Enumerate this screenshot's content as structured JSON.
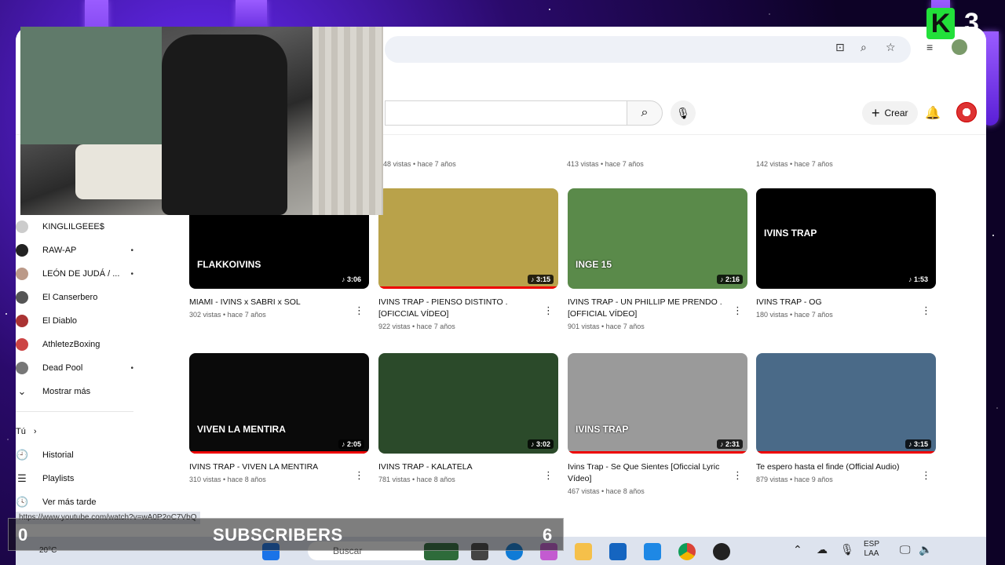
{
  "header": {
    "create_label": "Crear"
  },
  "taskbar": {
    "search_placeholder": "Buscar",
    "lang_top": "ESP",
    "lang_bottom": "LAA",
    "temp": "20°C"
  },
  "status": {
    "url": "https://www.youtube.com/watch?v=wA0P2oC7VbQ"
  },
  "overlay": {
    "subs_left": "0",
    "subs_label": "SUBSCRIBERS",
    "subs_right": "6",
    "brand_letter": "K",
    "brand_number": "3"
  },
  "top_row_meta": [
    "48 vistas • hace 7 años",
    "413 vistas • hace 7 años",
    "142 vistas • hace 7 años"
  ],
  "sidebar": {
    "subscriptions": [
      {
        "name": "KINGLILGEEE$",
        "dot": "",
        "color": "#ccc"
      },
      {
        "name": "RAW-AP",
        "dot": "•",
        "color": "#222"
      },
      {
        "name": "LEÓN DE JUDÁ / ...",
        "dot": "•",
        "color": "#b98"
      },
      {
        "name": "El Canserbero",
        "dot": "",
        "color": "#555"
      },
      {
        "name": "El Diablo",
        "dot": "",
        "color": "#a33"
      },
      {
        "name": "AthletezBoxing",
        "dot": "",
        "color": "#c44"
      },
      {
        "name": "Dead Pool",
        "dot": "•",
        "color": "#777"
      }
    ],
    "show_more": "Mostrar más",
    "you_label": "Tú",
    "you_items": [
      {
        "label": "Historial",
        "icon": "history-icon"
      },
      {
        "label": "Playlists",
        "icon": "playlist-icon"
      },
      {
        "label": "Ver más tarde",
        "icon": "watch-later-icon"
      }
    ]
  },
  "videos": [
    {
      "title": "MIAMI - IVINS x SABRI x SOL",
      "meta": "302 vistas • hace 7 años",
      "duration": "3:06",
      "thumb_text": "FLAKKOIVINS",
      "bg": "#000"
    },
    {
      "title": "IVINS TRAP - PIENSO DISTINTO . [OFICCIAL VÍDEO]",
      "meta": "922 vistas • hace 7 años",
      "duration": "3:15",
      "thumb_text": "",
      "bg": "#b9a24a"
    },
    {
      "title": "IVINS TRAP - UN PHILLIP ME PRENDO . [OFFICIAL VÍDEO]",
      "meta": "901 vistas • hace 7 años",
      "duration": "2:16",
      "thumb_text": "INGE 15",
      "bg": "#5a8a4a"
    },
    {
      "title": "IVINS TRAP - OG",
      "meta": "180 vistas • hace 7 años",
      "duration": "1:53",
      "thumb_text": "IVINS TRAP",
      "bg": "#000"
    },
    {
      "title": "IVINS TRAP - VIVEN LA MENTIRA",
      "meta": "310 vistas • hace 8 años",
      "duration": "2:05",
      "thumb_text": "VIVEN LA MENTIRA",
      "bg": "#0a0a0a"
    },
    {
      "title": "IVINS TRAP - KALATELA",
      "meta": "781 vistas • hace 8 años",
      "duration": "3:02",
      "thumb_text": "",
      "bg": "#2b4a2a"
    },
    {
      "title": "Ivins Trap - Se Que Sientes [Oficcial Lyric Vídeo]",
      "meta": "467 vistas • hace 8 años",
      "duration": "2:31",
      "thumb_text": "IVINS TRAP",
      "bg": "#9a9a9a"
    },
    {
      "title": "Te espero hasta el finde (Official Audio)",
      "meta": "879 vistas • hace 9 años",
      "duration": "3:15",
      "thumb_text": "",
      "bg": "#4a6a88"
    }
  ]
}
